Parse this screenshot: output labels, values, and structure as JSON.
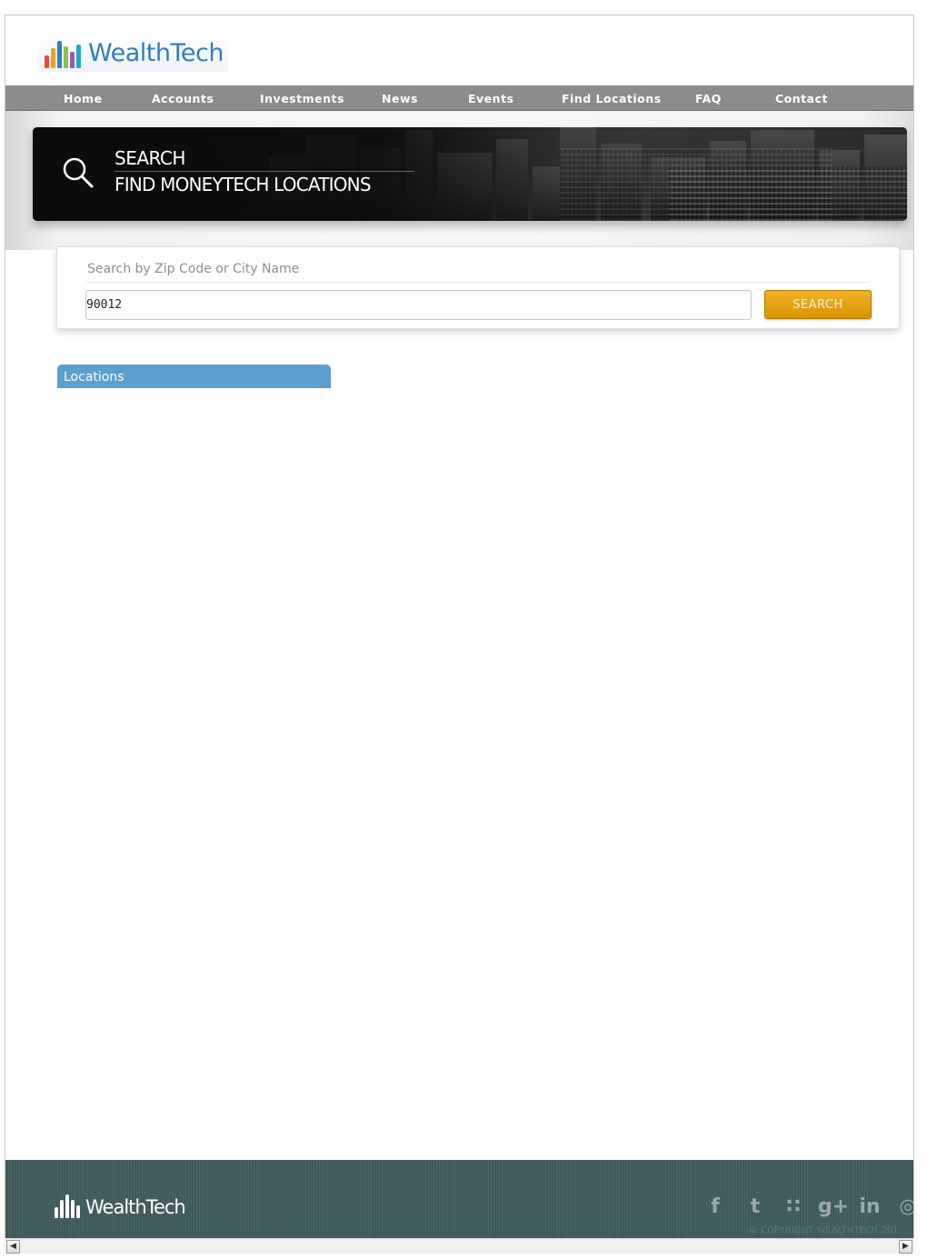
{
  "brand": {
    "name": "WealthTech",
    "accent": "#2f7fc1"
  },
  "nav": {
    "items": [
      {
        "label": "Home"
      },
      {
        "label": "Accounts"
      },
      {
        "label": "Investments"
      },
      {
        "label": "News"
      },
      {
        "label": "Events"
      },
      {
        "label": "Find Locations"
      },
      {
        "label": "FAQ"
      },
      {
        "label": "Contact"
      }
    ]
  },
  "banner": {
    "title": "SEARCH",
    "subtitle": "FIND MONEYTECH LOCATIONS",
    "icon": "search-icon"
  },
  "search": {
    "label": "Search by Zip Code or City Name",
    "value": "90012",
    "button_label": "SEARCH",
    "button_color": "#e5a10f"
  },
  "locations": {
    "header": "Locations",
    "color": "#5b9fd1"
  },
  "footer": {
    "brand": "WealthTech",
    "social": [
      {
        "icon": "facebook-icon",
        "glyph": "f"
      },
      {
        "icon": "twitter-icon",
        "glyph": "t"
      },
      {
        "icon": "rss-icon",
        "glyph": "∷"
      },
      {
        "icon": "google-plus-icon",
        "glyph": "g+"
      },
      {
        "icon": "linkedin-icon",
        "glyph": "in"
      },
      {
        "icon": "dribbble-icon",
        "glyph": "◎"
      }
    ],
    "copyright": "© COPYRIGHT WEALTHTECH 201",
    "bg_color": "#3f5a5a"
  },
  "scrollbar": {
    "left_icon": "scroll-left-icon",
    "right_icon": "scroll-right-icon"
  }
}
